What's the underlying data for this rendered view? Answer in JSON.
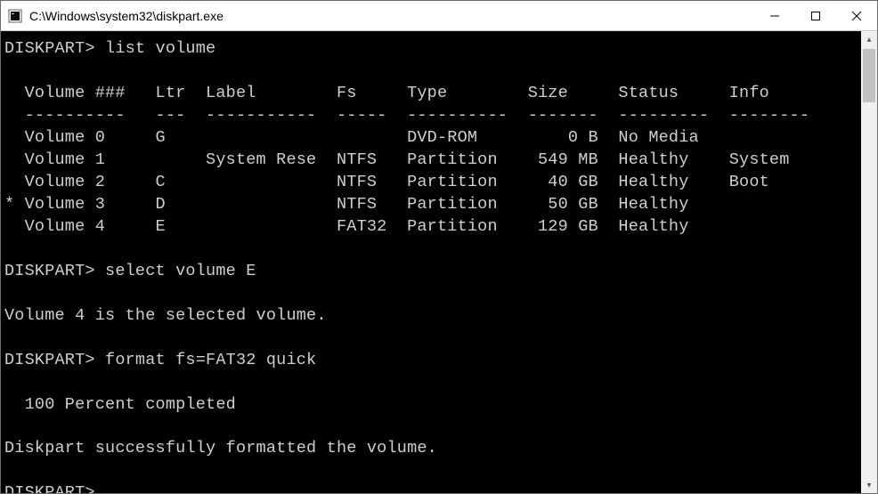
{
  "window": {
    "title": "C:\\Windows\\system32\\diskpart.exe"
  },
  "prompt": "DISKPART>",
  "commands": {
    "list_volume": "list volume",
    "select_volume": "select volume E",
    "format": "format fs=FAT32 quick"
  },
  "volume_table": {
    "headers": {
      "vol": "Volume ###",
      "ltr": "Ltr",
      "label": "Label",
      "fs": "Fs",
      "type": "Type",
      "size": "Size",
      "status": "Status",
      "info": "Info"
    },
    "rules": {
      "vol": "----------",
      "ltr": "---",
      "label": "-----------",
      "fs": "-----",
      "type": "----------",
      "size": "-------",
      "status": "---------",
      "info": "--------"
    },
    "rows": [
      {
        "sel": " ",
        "vol": "Volume 0",
        "ltr": "G",
        "label": "",
        "fs": "",
        "type": "DVD-ROM",
        "size": "0 B",
        "status": "No Media",
        "info": ""
      },
      {
        "sel": " ",
        "vol": "Volume 1",
        "ltr": "",
        "label": "System Rese",
        "fs": "NTFS",
        "type": "Partition",
        "size": "549 MB",
        "status": "Healthy",
        "info": "System"
      },
      {
        "sel": " ",
        "vol": "Volume 2",
        "ltr": "C",
        "label": "",
        "fs": "NTFS",
        "type": "Partition",
        "size": "40 GB",
        "status": "Healthy",
        "info": "Boot"
      },
      {
        "sel": "*",
        "vol": "Volume 3",
        "ltr": "D",
        "label": "",
        "fs": "NTFS",
        "type": "Partition",
        "size": "50 GB",
        "status": "Healthy",
        "info": ""
      },
      {
        "sel": " ",
        "vol": "Volume 4",
        "ltr": "E",
        "label": "",
        "fs": "FAT32",
        "type": "Partition",
        "size": "129 GB",
        "status": "Healthy",
        "info": ""
      }
    ]
  },
  "messages": {
    "selected": "Volume 4 is the selected volume.",
    "progress": "  100 Percent completed",
    "formatted": "Diskpart successfully formatted the volume."
  }
}
